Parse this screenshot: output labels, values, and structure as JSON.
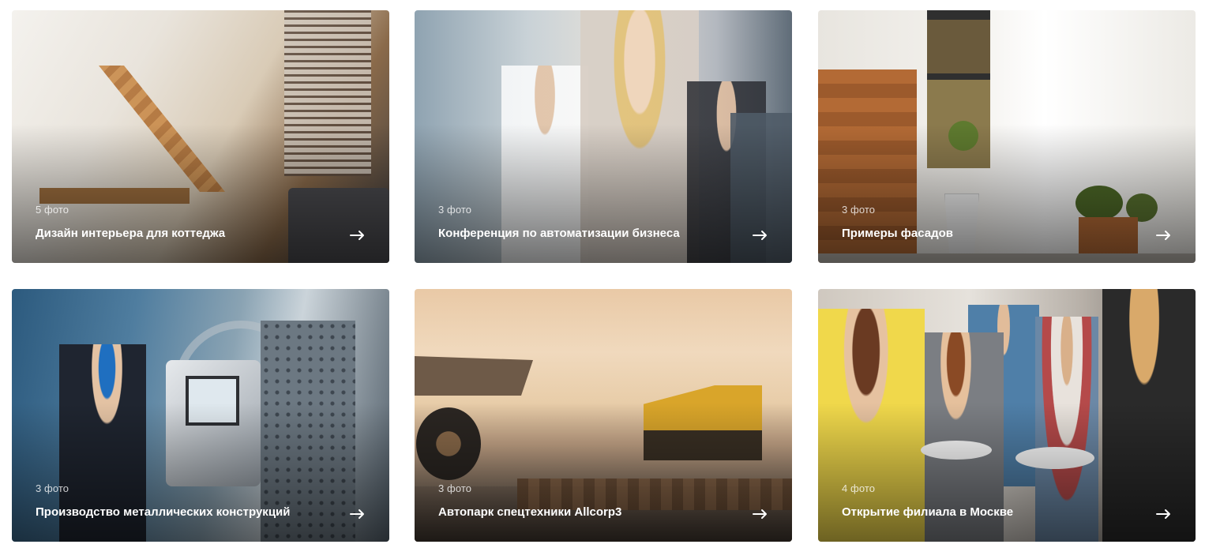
{
  "gallery": {
    "items": [
      {
        "count": "5 фото",
        "title": "Дизайн интерьера для коттеджа",
        "arrow_icon": "arrow-right-icon"
      },
      {
        "count": "3 фото",
        "title": "Конференция по автоматизации бизнеса",
        "arrow_icon": "arrow-right-icon"
      },
      {
        "count": "3 фото",
        "title": "Примеры фасадов",
        "arrow_icon": "arrow-right-icon"
      },
      {
        "count": "3 фото",
        "title": "Производство металлических конструкций",
        "arrow_icon": "arrow-right-icon"
      },
      {
        "count": "3 фото",
        "title": "Автопарк спецтехники Allcorp3",
        "arrow_icon": "arrow-right-icon"
      },
      {
        "count": "4 фото",
        "title": "Открытие филиала в Москве",
        "arrow_icon": "arrow-right-icon"
      }
    ]
  },
  "colors": {
    "title_text": "#ffffff",
    "count_text": "#dcdcdc",
    "page_background": "#ffffff"
  }
}
